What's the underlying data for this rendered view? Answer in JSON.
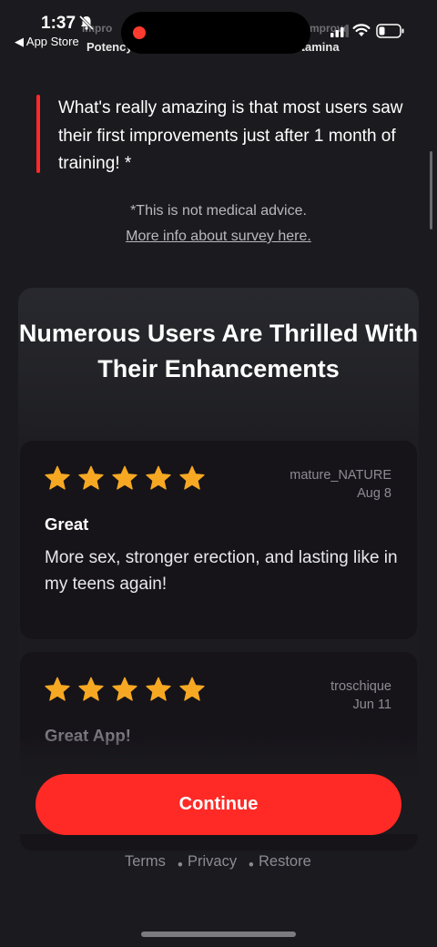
{
  "status_bar": {
    "time": "1:37",
    "back_label": "◀ App Store",
    "ghost_tabs": [
      "Impro",
      "Potency",
      "mprove",
      "Stamina"
    ]
  },
  "quote": {
    "text": "What's really amazing is that most users saw their first improvements just after 1 month of training! *"
  },
  "disclaimer": {
    "note": "*This is not medical advice.",
    "link": "More info about survey here."
  },
  "reviews_section": {
    "title": "Numerous Users Are Thrilled With Their Enhancements",
    "reviews": [
      {
        "rating": 5,
        "author": "mature_NATURE",
        "date": "Aug 8",
        "title": "Great",
        "body": "More sex, stronger erection, and lasting like in my teens again!"
      },
      {
        "rating": 5,
        "author": "troschique",
        "date": "Jun 11",
        "title": "Great App!",
        "body": ""
      }
    ]
  },
  "cta": {
    "label": "Continue"
  },
  "footer": {
    "terms": "Terms",
    "privacy": "Privacy",
    "restore": "Restore",
    "separator": "•"
  },
  "colors": {
    "accent": "#ff2a26",
    "star": "#f7a823",
    "background": "#1b1a1e"
  },
  "icons": {
    "notifications": "bell-slash-icon",
    "wifi": "wifi-icon",
    "signal": "signal-icon",
    "battery": "battery-icon",
    "star": "star-icon"
  }
}
